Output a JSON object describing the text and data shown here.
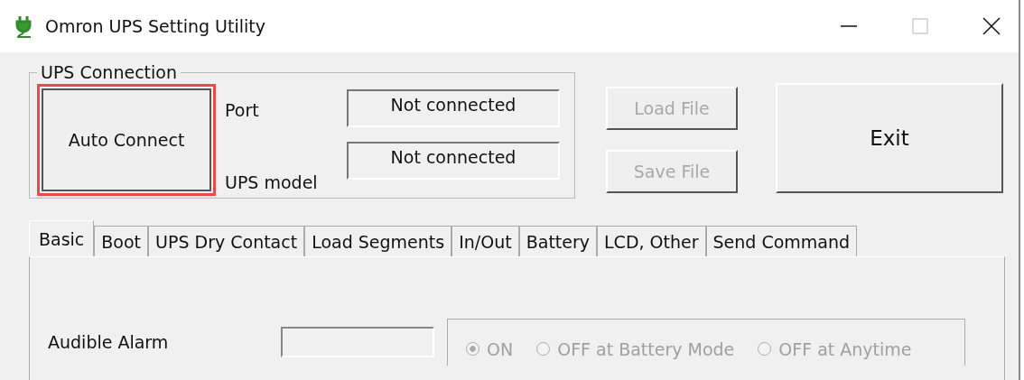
{
  "window": {
    "title": "Omron UPS Setting Utility"
  },
  "connection": {
    "title": "UPS Connection",
    "button": {
      "label": "Auto Connect",
      "highlighted": true
    },
    "fields": [
      {
        "label": "Port",
        "value": "Not connected"
      },
      {
        "label": "UPS model",
        "value": "Not connected"
      }
    ]
  },
  "file_buttons": [
    {
      "label": "Load File",
      "disabled": true
    },
    {
      "label": "Save File",
      "disabled": true
    }
  ],
  "exit_button": {
    "label": "Exit"
  },
  "tabs": [
    {
      "label": "Basic",
      "selected": true
    },
    {
      "label": "Boot",
      "selected": false
    },
    {
      "label": "UPS Dry Contact",
      "selected": false
    },
    {
      "label": "Load Segments",
      "selected": false
    },
    {
      "label": "In/Out",
      "selected": false
    },
    {
      "label": "Battery",
      "selected": false
    },
    {
      "label": "LCD, Other",
      "selected": false
    },
    {
      "label": "Send Command",
      "selected": false
    }
  ],
  "audible_alarm": {
    "label": "Audible Alarm",
    "disabled": true,
    "options": [
      {
        "label": "ON",
        "selected": true
      },
      {
        "label": "OFF at Battery Mode",
        "selected": false
      },
      {
        "label": "OFF at Anytime",
        "selected": false
      }
    ]
  }
}
